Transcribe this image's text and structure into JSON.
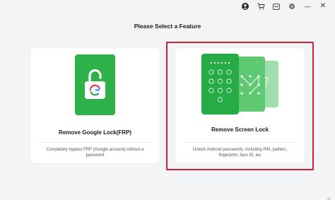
{
  "window": {
    "icons": [
      "account-icon",
      "cart-icon",
      "mail-icon",
      "settings-icon",
      "minimize-icon",
      "close-icon"
    ],
    "minimize_glyph": "—",
    "close_glyph": "✕"
  },
  "page": {
    "title": "Please Select a Feature"
  },
  "features": [
    {
      "title": "Remove Google Lock(FRP)",
      "description": "Completely bypass FRP (Google account) without a password",
      "icon": "google-unlock-icon",
      "selected": false
    },
    {
      "title": "Remove Screen Lock",
      "description": "Unlock Android passwords, including PIN, pattern, fingerprint, face ID, etc",
      "icon": "screen-lock-stack-icon",
      "selected": true
    }
  ],
  "colors": {
    "green_primary": "#2fb14a",
    "green_mid": "#5ec873",
    "green_light": "#9fdfae",
    "selection_red": "#cf1f35",
    "google_blue": "#4285f4",
    "google_red": "#ea4335",
    "google_yellow": "#fbbc05",
    "google_green": "#34a853"
  }
}
